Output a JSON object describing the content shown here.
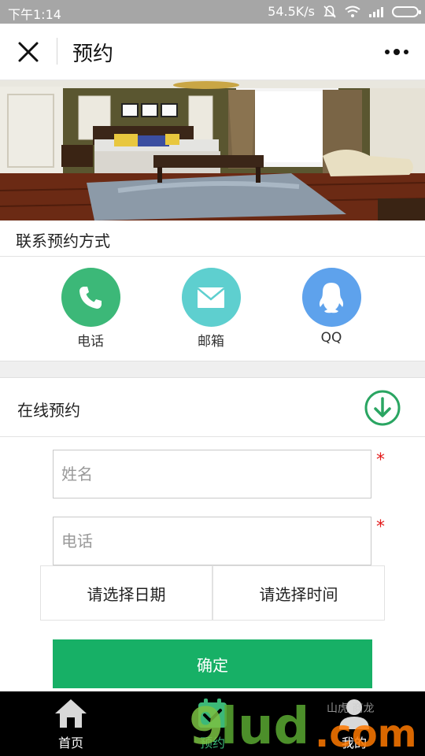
{
  "status_bar": {
    "time": "下午1:14",
    "network_speed": "54.5K/s"
  },
  "header": {
    "title": "预约"
  },
  "contact_section": {
    "title": "联系预约方式",
    "items": [
      {
        "label": "电话",
        "icon": "phone-icon",
        "color": "#3cb878"
      },
      {
        "label": "邮箱",
        "icon": "mail-icon",
        "color": "#5ecfcf"
      },
      {
        "label": "QQ",
        "icon": "qq-icon",
        "color": "#5ea2ec"
      }
    ]
  },
  "online_booking": {
    "title": "在线预约",
    "icon": "download-circle-icon",
    "accent": "#2aa562"
  },
  "form": {
    "name_placeholder": "姓名",
    "phone_placeholder": "电话",
    "required_mark": "*",
    "date_label": "请选择日期",
    "time_label": "请选择时间",
    "submit_label": "确定",
    "submit_color": "#17b066"
  },
  "tab_bar": {
    "items": [
      {
        "label": "首页",
        "icon": "home-icon"
      },
      {
        "label": "预约",
        "icon": "calendar-check-icon"
      },
      {
        "label": "我的",
        "icon": "user-icon"
      }
    ]
  },
  "watermark": {
    "text": "9lud.com",
    "tagline": "山虎 商龙"
  }
}
